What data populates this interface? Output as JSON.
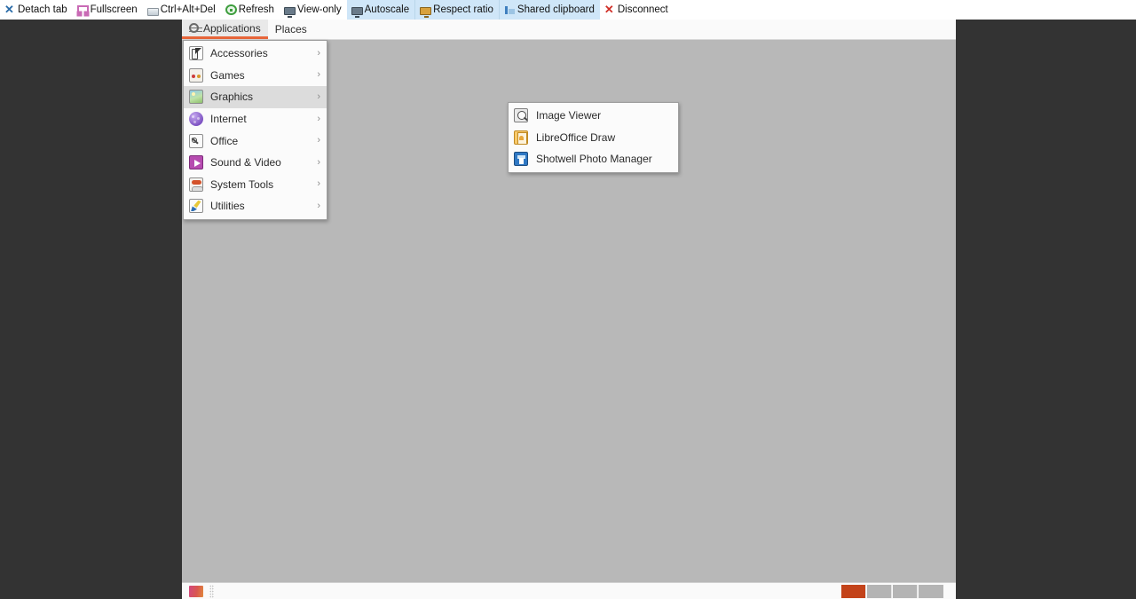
{
  "vnc_toolbar": {
    "buttons": [
      {
        "label": "Detach tab",
        "icon": "scissors-icon",
        "highlighted": false,
        "separator": false
      },
      {
        "label": "Fullscreen",
        "icon": "fullscreen-icon",
        "highlighted": false,
        "separator": false
      },
      {
        "label": "Ctrl+Alt+Del",
        "icon": "keyboard-icon",
        "highlighted": false,
        "separator": false
      },
      {
        "label": "Refresh",
        "icon": "refresh-icon",
        "highlighted": false,
        "separator": false
      },
      {
        "label": "View-only",
        "icon": "monitor-icon",
        "highlighted": false,
        "separator": false
      },
      {
        "label": "Autoscale",
        "icon": "monitor-scale-icon",
        "highlighted": true,
        "separator": false
      },
      {
        "label": "Respect ratio",
        "icon": "monitor-ratio-icon",
        "highlighted": true,
        "separator": true
      },
      {
        "label": "Shared clipboard",
        "icon": "clipboard-icon",
        "highlighted": true,
        "separator": true
      },
      {
        "label": "Disconnect",
        "icon": "close-x-icon",
        "highlighted": false,
        "separator": false
      }
    ]
  },
  "desktop": {
    "background_color": "#b8b8b8",
    "frame_color": "#333333",
    "top_panel": {
      "menus": [
        {
          "label": "Applications",
          "icon": "gnome-gear-icon",
          "active": true
        },
        {
          "label": "Places",
          "icon": "",
          "active": false
        }
      ],
      "active_underline_color": "#e8663a"
    },
    "applications_menu": {
      "items": [
        {
          "label": "Accessories",
          "icon": "accessories-icon",
          "selected": false,
          "has_submenu": true,
          "chevron": "›"
        },
        {
          "label": "Games",
          "icon": "games-icon",
          "selected": false,
          "has_submenu": true,
          "chevron": "›"
        },
        {
          "label": "Graphics",
          "icon": "graphics-icon",
          "selected": true,
          "has_submenu": true,
          "chevron": "›"
        },
        {
          "label": "Internet",
          "icon": "internet-icon",
          "selected": false,
          "has_submenu": true,
          "chevron": "›"
        },
        {
          "label": "Office",
          "icon": "office-icon",
          "selected": false,
          "has_submenu": true,
          "chevron": "›"
        },
        {
          "label": "Sound & Video",
          "icon": "sound-video-icon",
          "selected": false,
          "has_submenu": true,
          "chevron": "›"
        },
        {
          "label": "System Tools",
          "icon": "system-tools-icon",
          "selected": false,
          "has_submenu": true,
          "chevron": "›"
        },
        {
          "label": "Utilities",
          "icon": "utilities-icon",
          "selected": false,
          "has_submenu": true,
          "chevron": "›"
        }
      ]
    },
    "graphics_submenu": {
      "items": [
        {
          "label": "Image Viewer",
          "icon": "image-viewer-icon"
        },
        {
          "label": "LibreOffice Draw",
          "icon": "libreoffice-draw-icon"
        },
        {
          "label": "Shotwell Photo Manager",
          "icon": "shotwell-icon"
        }
      ]
    },
    "bottom_panel": {
      "show_desktop_icon": "show-desktop-icon",
      "workspaces": [
        {
          "active": true
        },
        {
          "active": false
        },
        {
          "active": false
        },
        {
          "active": false
        }
      ],
      "active_workspace_color": "#c3431a"
    }
  }
}
